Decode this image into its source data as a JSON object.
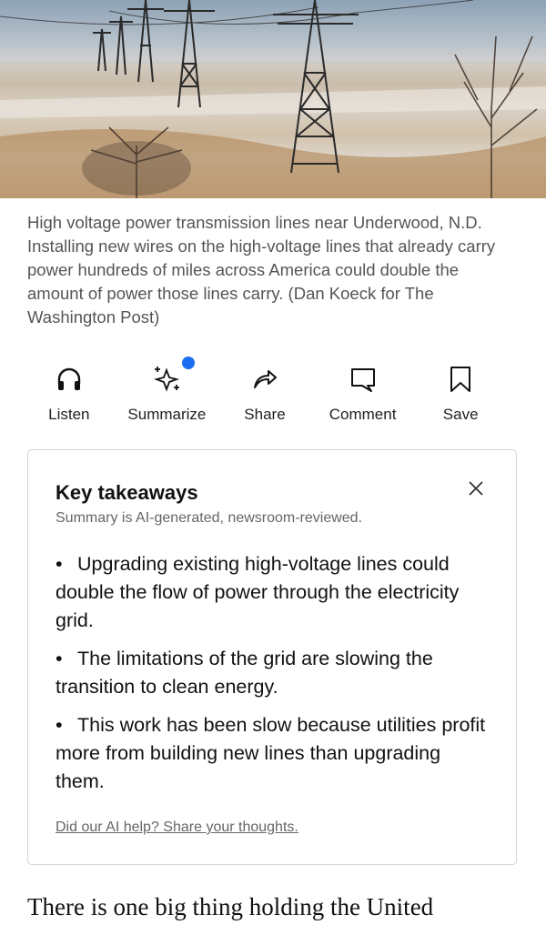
{
  "photo": {
    "caption": "High voltage power transmission lines near Underwood, N.D. Installing new wires on the high-voltage lines that already carry power hundreds of miles across America could double the amount of power those lines carry. (Dan Koeck for The Washington Post)"
  },
  "actions": [
    {
      "label": "Listen",
      "icon": "headphones-icon"
    },
    {
      "label": "Summarize",
      "icon": "sparkles-icon"
    },
    {
      "label": "Share",
      "icon": "share-arrow-icon"
    },
    {
      "label": "Comment",
      "icon": "comment-icon"
    },
    {
      "label": "Save",
      "icon": "bookmark-icon"
    }
  ],
  "colors": {
    "notification_dot": "#1a6ef2",
    "border": "#d4d4d4"
  },
  "takeaways": {
    "title": "Key takeaways",
    "subtitle": "Summary is AI-generated, newsroom-reviewed.",
    "items": [
      "Upgrading existing high-voltage lines could double the flow of power through the electricity grid.",
      "The limitations of the grid are slowing the transition to clean energy.",
      "This work has been slow because utilities profit more from building new lines than upgrading them."
    ],
    "feedback_link": "Did our AI help? Share your thoughts."
  },
  "article": {
    "first_line": "There is one big thing holding the United"
  }
}
